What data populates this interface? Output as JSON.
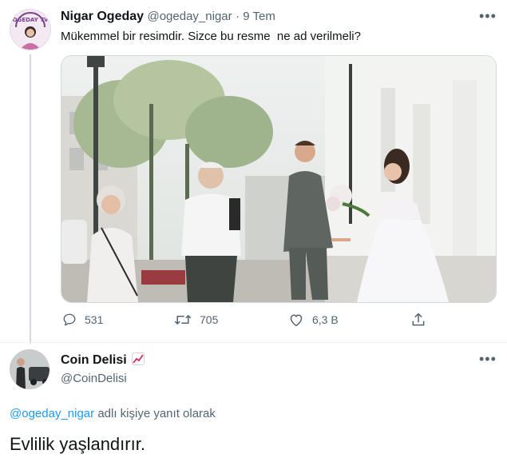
{
  "tweet": {
    "author_name": "Nigar Ogeday",
    "author_handle": "@ogeday_nigar",
    "time": "· 9 Tem",
    "text": "Mükemmel bir resimdir. Sizce bu resme  ne ad verilmeli?",
    "avatar_logo_text": "OGEDAY TV",
    "stats": {
      "replies": "531",
      "retweets": "705",
      "likes": "6,3 B"
    }
  },
  "reply": {
    "author_name": "Coin Delisi",
    "author_handle": "@CoinDelisi",
    "reply_to_handle": "@ogeday_nigar",
    "reply_to_suffix": "adlı kişiye yanıt olarak",
    "text": "Evlilik yaşlandırır."
  },
  "icons": {
    "more": "more-icon",
    "reply": "reply-icon",
    "retweet": "retweet-icon",
    "like": "heart-icon",
    "share": "share-icon",
    "badge": "chart-up-emoji"
  },
  "colors": {
    "link": "#1d9bf0",
    "secondary_text": "#536471",
    "badge": "#e0245e"
  }
}
